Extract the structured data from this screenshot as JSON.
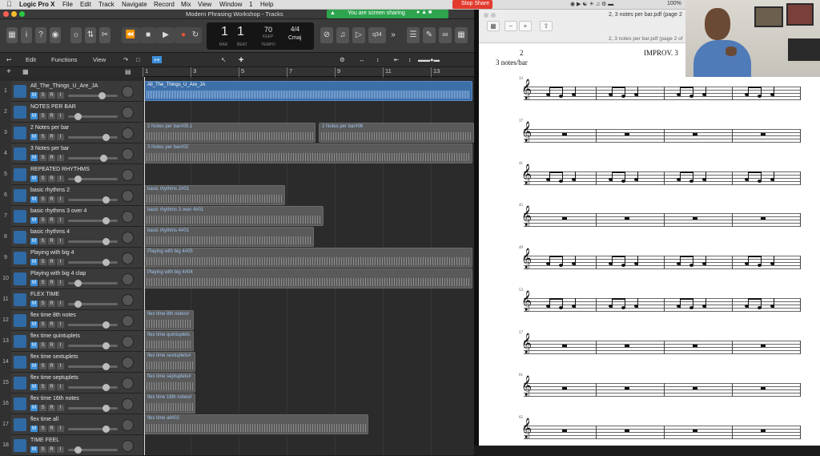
{
  "menubar": {
    "app": "Logic Pro X",
    "items": [
      "File",
      "Edit",
      "Track",
      "Navigate",
      "Record",
      "Mix",
      "View",
      "Window",
      "1",
      "Help"
    ],
    "battery": "100%"
  },
  "window": {
    "title": "Modern Phrasing Workshop - Tracks"
  },
  "screenshare": {
    "banner": "You are screen sharing",
    "stop": "Stop Share"
  },
  "lcd": {
    "bar": "1",
    "beat": "1",
    "tempo": "70",
    "sig": "4/4",
    "key": "Cmaj",
    "bar_label": "BAR",
    "beat_label": "BEAT",
    "tempo_label": "TEMPO",
    "keep_label": "KEEP"
  },
  "controls": {
    "counter": "q34"
  },
  "trackheader": {
    "edit": "Edit",
    "functions": "Functions",
    "view": "View"
  },
  "ruler": [
    "1",
    "3",
    "5",
    "7",
    "9",
    "11",
    "13"
  ],
  "tracks": [
    {
      "num": "1",
      "name": "All_The_Things_U_Are_JA"
    },
    {
      "num": "2",
      "name": "NOTES PER BAR"
    },
    {
      "num": "3",
      "name": "2 Notes per bar"
    },
    {
      "num": "4",
      "name": "3 Notes per bar"
    },
    {
      "num": "5",
      "name": "REPEATED RHYTHMS"
    },
    {
      "num": "6",
      "name": "basic rhythms 2"
    },
    {
      "num": "7",
      "name": "basic rhythms 3 over 4"
    },
    {
      "num": "8",
      "name": "basic rhythms 4"
    },
    {
      "num": "9",
      "name": "Playing with big 4"
    },
    {
      "num": "10",
      "name": "Playing with big 4 clap"
    },
    {
      "num": "11",
      "name": "FLEX TIME"
    },
    {
      "num": "12",
      "name": "flex time 8th notes"
    },
    {
      "num": "13",
      "name": "flex time quintuplets"
    },
    {
      "num": "14",
      "name": "flex time sextuplets"
    },
    {
      "num": "15",
      "name": "flex time septuplets"
    },
    {
      "num": "16",
      "name": "flex time 16th notes"
    },
    {
      "num": "17",
      "name": "flex time all"
    },
    {
      "num": "18",
      "name": "TIME FEEL"
    }
  ],
  "buttons": {
    "m": "M",
    "s": "S",
    "r": "R",
    "i": "I"
  },
  "regions": [
    "All_The_Things_U_Are_JA",
    "2 Notes per bar#05.1",
    "2 Notes per bar#06",
    "3 Notes per bar#02",
    "basic rhythms 2#01",
    "basic rhythms 3 over 4#01",
    "basic rhythms 4#01",
    "Playing with big 4#05",
    "Playing with big 4#04",
    "flex time 8th notes#",
    "flex time quintuplets",
    "flex time sextuplets#",
    "flex time septuplets#",
    "flex time 16th notes#",
    "flex time all#02"
  ],
  "pdf": {
    "title": "2, 3 notes per bar.pdf (page 2",
    "subtitle": "2, 3 notes per bar.pdf (page 2 of",
    "page_num": "2",
    "page_head": "IMPROV. 3",
    "page_sub": "3 notes/bar",
    "measures": [
      "33",
      "37",
      "41",
      "45",
      "49",
      "53",
      "57",
      "61",
      "65"
    ]
  }
}
